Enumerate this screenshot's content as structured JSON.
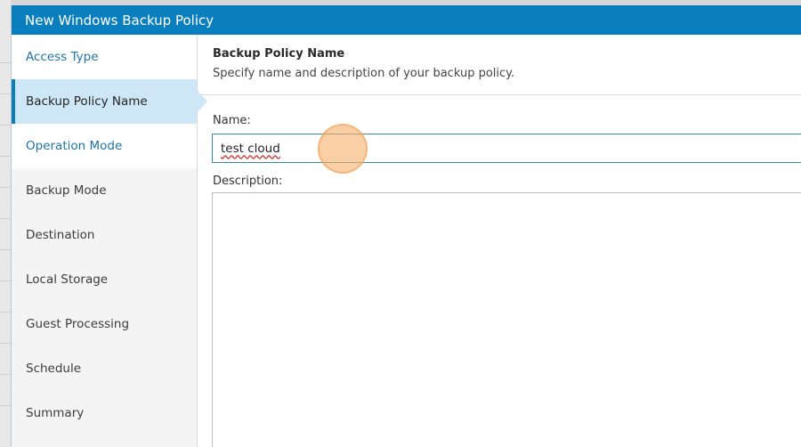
{
  "dialog": {
    "title": "New Windows Backup Policy"
  },
  "steps": [
    {
      "label": "Access Type",
      "state": "done"
    },
    {
      "label": "Backup Policy Name",
      "state": "active"
    },
    {
      "label": "Operation Mode",
      "state": "done"
    },
    {
      "label": "Backup Mode",
      "state": "pending"
    },
    {
      "label": "Destination",
      "state": "pending"
    },
    {
      "label": "Local Storage",
      "state": "pending"
    },
    {
      "label": "Guest Processing",
      "state": "pending"
    },
    {
      "label": "Schedule",
      "state": "pending"
    },
    {
      "label": "Summary",
      "state": "pending"
    }
  ],
  "header": {
    "title": "Backup Policy Name",
    "subtitle": "Specify name and description of your backup policy."
  },
  "form": {
    "name_label": "Name:",
    "name_value": "test cloud",
    "description_label": "Description:",
    "description_value": ""
  },
  "colors": {
    "titlebar": "#0b7fbd",
    "active_step": "#cde7f6",
    "done_step_text": "#1f74a6",
    "click_indicator": "#f7b26e"
  }
}
